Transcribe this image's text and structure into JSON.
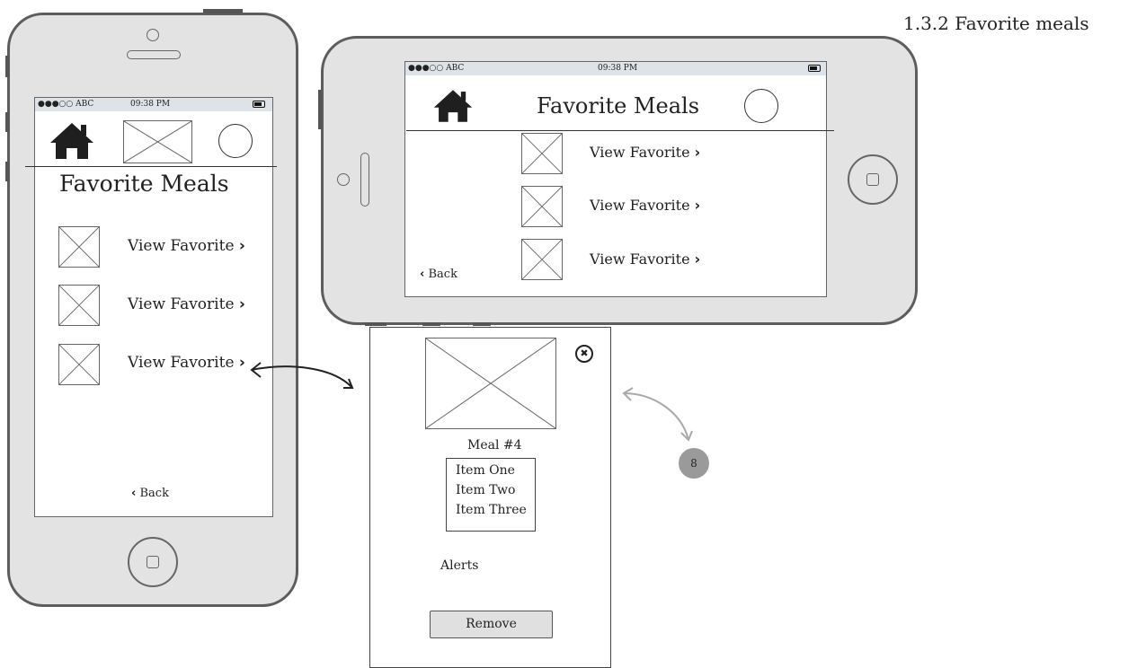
{
  "page": {
    "title": "1.3.2 Favorite meals"
  },
  "portrait": {
    "status": {
      "carrier": "●●●○○ ABC",
      "time": "09:38 PM"
    },
    "heading": "Favorite Meals",
    "items": [
      {
        "label": "View Favorite"
      },
      {
        "label": "View Favorite"
      },
      {
        "label": "View Favorite"
      }
    ],
    "chevron": "›",
    "back": {
      "chevron": "‹",
      "label": "Back"
    }
  },
  "landscape": {
    "status": {
      "carrier": "●●●○○ ABC",
      "time": "09:38 PM"
    },
    "heading": "Favorite Meals",
    "items": [
      {
        "label": "View Favorite"
      },
      {
        "label": "View Favorite"
      },
      {
        "label": "View Favorite"
      }
    ],
    "chevron": "›",
    "back": {
      "chevron": "‹",
      "label": "Back"
    }
  },
  "detail": {
    "meal_title": "Meal #4",
    "items": [
      "Item One",
      "Item Two",
      "Item Three"
    ],
    "alerts_label": "Alerts",
    "remove_label": "Remove",
    "close_glyph": "✖"
  },
  "annotation": {
    "badge": "8"
  },
  "colors": {
    "phone_body": "#e3e3e3",
    "phone_border": "#5d5d5d",
    "status_bar": "#dde3e6",
    "badge": "#9a9a9a"
  }
}
